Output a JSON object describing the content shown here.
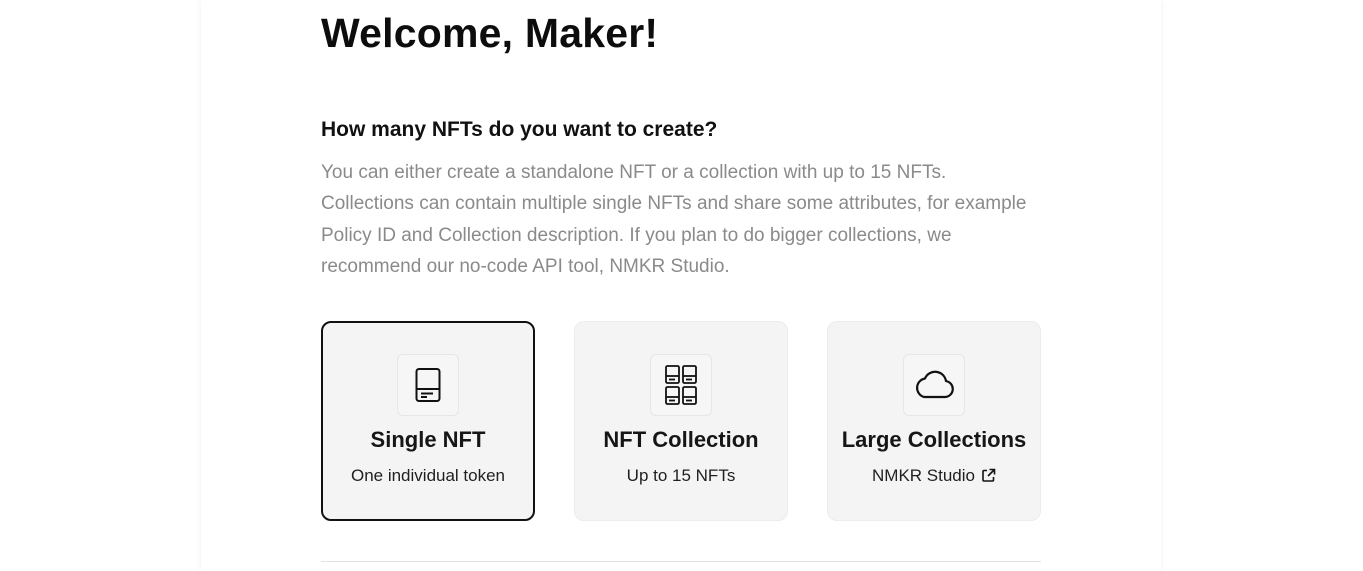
{
  "header": {
    "welcome": "Welcome, Maker!"
  },
  "intro": {
    "question": "How many NFTs do you want to create?",
    "description": "You can either create a standalone NFT or a collection with up to 15 NFTs. Collections can contain multiple single NFTs and share some attributes, for example Policy ID and Collection description. If you plan to do bigger collections, we recommend our no-code API tool, NMKR Studio."
  },
  "options": [
    {
      "title": "Single NFT",
      "subtitle": "One individual token",
      "icon": "single-card-icon",
      "selected": true
    },
    {
      "title": "NFT Collection",
      "subtitle": "Up to 15 NFTs",
      "icon": "grid-cards-icon",
      "selected": false
    },
    {
      "title": "Large Collections",
      "subtitle": "NMKR Studio",
      "icon": "cloud-icon",
      "selected": false,
      "external_link_icon": "external-link-icon"
    }
  ],
  "colors": {
    "card_background": "#f3f4f3",
    "selected_border": "#111111",
    "description_text": "#8a8a8a"
  }
}
